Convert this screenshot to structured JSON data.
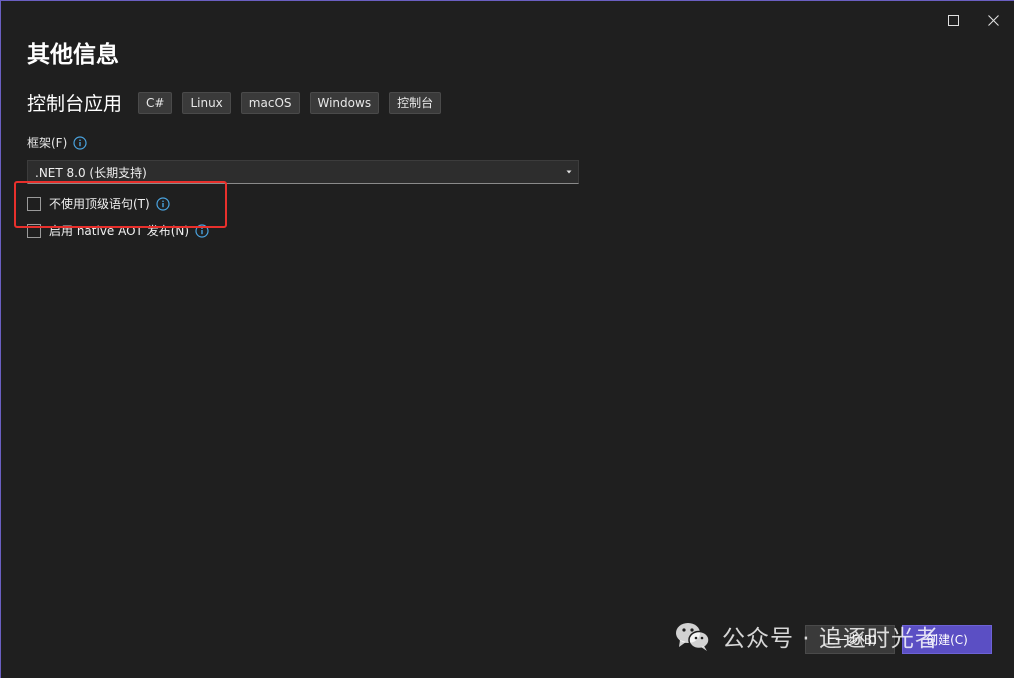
{
  "window": {
    "maximize_icon": "maximize-icon",
    "close_icon": "close-icon"
  },
  "header": {
    "title": "其他信息",
    "subtitle": "控制台应用",
    "tags": [
      "C#",
      "Linux",
      "macOS",
      "Windows",
      "控制台"
    ]
  },
  "framework": {
    "label": "框架(F)",
    "selected": ".NET 8.0 (长期支持)"
  },
  "options": {
    "top_level_statements": "不使用顶级语句(T)",
    "native_aot": "启用 native AOT 发布(N)"
  },
  "footer": {
    "back_label": "上一步(B)",
    "create_label": "创建(C)"
  },
  "watermark": {
    "text": "公众号 · 追逐时光者"
  },
  "colors": {
    "background": "#1f1f1f",
    "accent": "#5b4fc4",
    "highlight": "#e8302c",
    "info": "#4aa3df"
  }
}
